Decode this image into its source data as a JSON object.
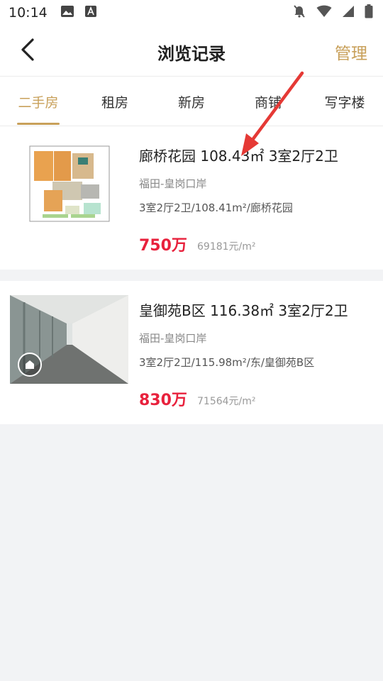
{
  "status_bar": {
    "time": "10:14"
  },
  "header": {
    "title": "浏览记录",
    "manage_label": "管理"
  },
  "tabs": [
    {
      "label": "二手房",
      "active": true
    },
    {
      "label": "租房"
    },
    {
      "label": "新房"
    },
    {
      "label": "商铺"
    },
    {
      "label": "写字楼"
    }
  ],
  "listings": [
    {
      "title": "廊桥花园 108.43㎡ 3室2厅2卫",
      "area": "福田-皇岗口岸",
      "desc": "3室2厅2卫/108.41m²/廊桥花园",
      "price": "750万",
      "unit_price": "69181元/m²"
    },
    {
      "title": "皇御苑B区 116.38㎡ 3室2厅2卫",
      "area": "福田-皇岗口岸",
      "desc": "3室2厅2卫/115.98m²/东/皇御苑B区",
      "price": "830万",
      "unit_price": "71564元/m²"
    }
  ],
  "colors": {
    "accent": "#c8a05a",
    "price": "#e8213c",
    "annotation_arrow": "#e53935"
  },
  "icons": [
    "image-icon",
    "font-icon",
    "bell-off-icon",
    "wifi-icon",
    "signal-icon",
    "battery-icon",
    "back-arrow-icon",
    "vr-icon"
  ]
}
